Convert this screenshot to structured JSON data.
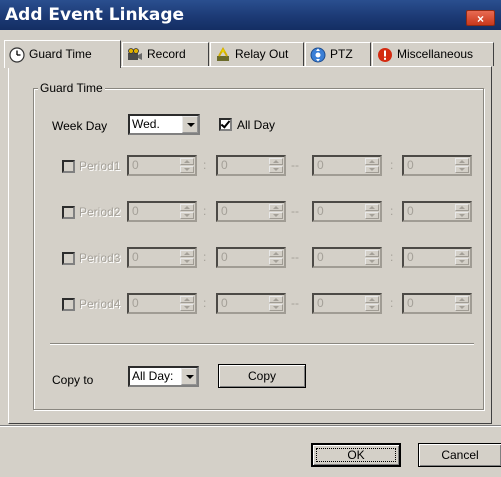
{
  "window": {
    "title": "Add Event Linkage",
    "close_glyph": "×"
  },
  "tabs": [
    {
      "label": "Guard Time",
      "icon": "clock-icon",
      "active": true
    },
    {
      "label": "Record",
      "icon": "camera-icon",
      "active": false
    },
    {
      "label": "Relay Out",
      "icon": "relay-icon",
      "active": false
    },
    {
      "label": "PTZ",
      "icon": "ptz-icon",
      "active": false
    },
    {
      "label": "Miscellaneous",
      "icon": "alert-icon",
      "active": false
    }
  ],
  "guard_time": {
    "group_label": "Guard Time",
    "week_day_label": "Week Day",
    "week_day_value": "Wed.",
    "all_day_label": "All Day",
    "all_day_checked": true,
    "periods": [
      {
        "label": "Period1",
        "start_h": "0",
        "start_m": "0",
        "end_h": "0",
        "end_m": "0"
      },
      {
        "label": "Period2",
        "start_h": "0",
        "start_m": "0",
        "end_h": "0",
        "end_m": "0"
      },
      {
        "label": "Period3",
        "start_h": "0",
        "start_m": "0",
        "end_h": "0",
        "end_m": "0"
      },
      {
        "label": "Period4",
        "start_h": "0",
        "start_m": "0",
        "end_h": "0",
        "end_m": "0"
      }
    ],
    "colon": ":",
    "dash": "--",
    "copy_to_label": "Copy to",
    "copy_to_value": "All Day:",
    "copy_button": "Copy"
  },
  "footer": {
    "ok_button": "OK",
    "cancel_button": "Cancel"
  },
  "colors": {
    "titlebar": "#1c3a75",
    "dialog_face": "#d4d0c8",
    "close_button": "#c9381c"
  }
}
